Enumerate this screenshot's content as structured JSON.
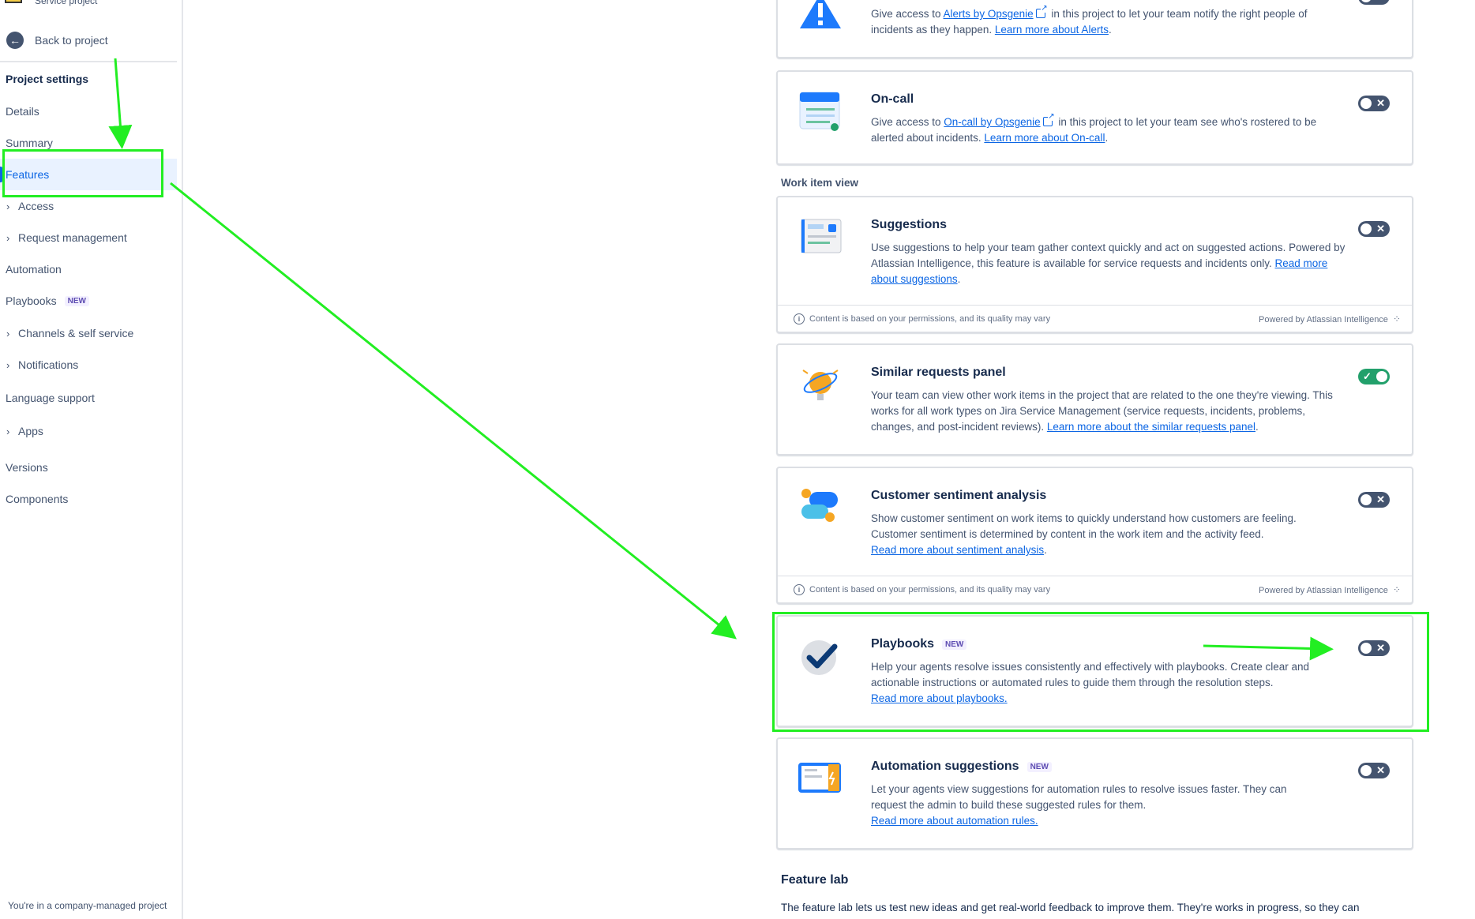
{
  "sidebar": {
    "project_type": "Service project",
    "back_label": "Back to project",
    "section_title": "Project settings",
    "items": [
      {
        "label": "Details"
      },
      {
        "label": "Summary"
      },
      {
        "label": "Features"
      },
      {
        "label": "Access"
      },
      {
        "label": "Request management"
      },
      {
        "label": "Automation"
      },
      {
        "label": "Playbooks",
        "badge": "NEW"
      },
      {
        "label": "Channels & self service"
      },
      {
        "label": "Notifications"
      },
      {
        "label": "Language support"
      },
      {
        "label": "Apps"
      },
      {
        "label": "Versions"
      },
      {
        "label": "Components"
      }
    ],
    "footer_note": "You're in a company-managed project"
  },
  "cards": {
    "alerts": {
      "desc_prefix": "Give access to ",
      "link": "Alerts by Opsgenie",
      "desc_middle": " in this project to let your team notify the right people of incidents as they happen. ",
      "learn_more": "Learn more about Alerts",
      "toggle": "off"
    },
    "oncall": {
      "title": "On-call",
      "desc_prefix": "Give access to ",
      "link": "On-call by Opsgenie",
      "desc_middle": " in this project to let your team see who's rostered to be alerted about incidents. ",
      "learn_more": "Learn more about On-call",
      "toggle": "off"
    },
    "suggestions": {
      "title": "Suggestions",
      "desc": "Use suggestions to help your team gather context quickly and act on suggested actions. Powered by Atlassian Intelligence, this feature is available for service requests and incidents only. ",
      "learn_more": "Read more about suggestions",
      "toggle": "off"
    },
    "similar": {
      "title": "Similar requests panel",
      "desc": "Your team can view other work items in the project that are related to the one they're viewing. This works for all work types on Jira Service Management (service requests, incidents, problems, changes, and post-incident reviews). ",
      "learn_more": "Learn more about the similar requests panel",
      "toggle": "on"
    },
    "sentiment": {
      "title": "Customer sentiment analysis",
      "desc": "Show customer sentiment on work items to quickly understand how customers are feeling. Customer sentiment is determined by content in the work item and the activity feed.",
      "learn_more": "Read more about sentiment analysis",
      "toggle": "off"
    },
    "playbooks": {
      "title": "Playbooks",
      "badge": "NEW",
      "desc": "Help your agents resolve issues consistently and effectively with playbooks. Create clear and actionable instructions or automated rules to guide them through the resolution steps.",
      "learn_more": "Read more about playbooks.",
      "toggle": "off"
    },
    "automation": {
      "title": "Automation suggestions",
      "badge": "NEW",
      "desc": "Let your agents view suggestions for automation rules to resolve issues faster. They can request the admin to build these suggested rules for them.",
      "learn_more": "Read more about automation rules.",
      "toggle": "off"
    }
  },
  "ai_footer": {
    "left": "Content is based on your permissions, and its quality may vary",
    "right": "Powered by Atlassian Intelligence"
  },
  "section_work_item_view": "Work item view",
  "feature_lab": {
    "title": "Feature lab",
    "desc": "The feature lab lets us test new ideas and get real-world feedback to improve them. They're works in progress, so they can"
  },
  "colors": {
    "accent": "#0c66e4",
    "annotation": "#22ee22",
    "toggle_on": "#22a06b",
    "toggle_off": "#44546f"
  }
}
